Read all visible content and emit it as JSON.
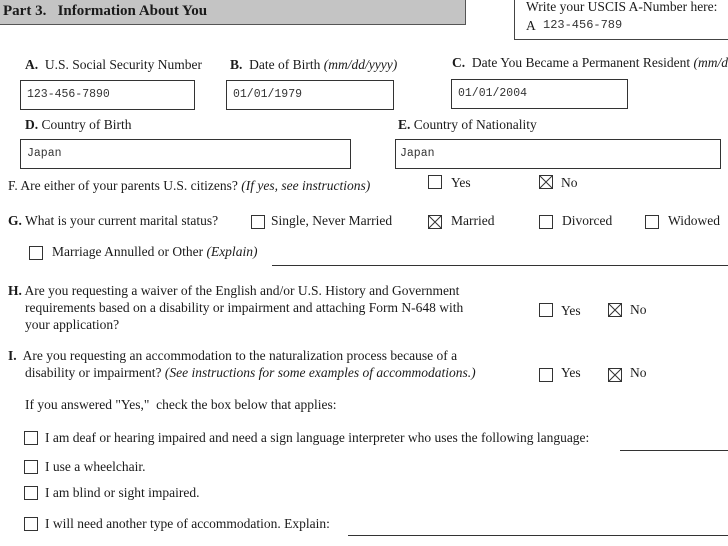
{
  "part": {
    "title": "Part 3.   Information About You"
  },
  "a_number": {
    "label": "Write your USCIS  A-Number here:",
    "prefix": "A",
    "value": "123-456-789"
  },
  "fields": {
    "ssn": {
      "letter": "A.",
      "label": "U.S. Social Security Number",
      "value": "123-456-7890"
    },
    "dob": {
      "letter": "B.",
      "label": "Date of Birth",
      "hint": "(mm/dd/yyyy)",
      "value": "01/01/1979"
    },
    "pr_date": {
      "letter": "C.",
      "label": "Date You Became a Permanent Resident",
      "hint": "(mm/dd/yyyy)",
      "value": "01/01/2004"
    },
    "birth_country": {
      "letter": "D.",
      "label": "Country of Birth",
      "value": "Japan"
    },
    "nationality": {
      "letter": "E.",
      "label": "Country of Nationality",
      "value": "Japan"
    }
  },
  "questions": {
    "f": {
      "text": "F. Are either of your parents U.S. citizens?",
      "hint": "(If yes, see instructions)",
      "options": [
        {
          "label": "Yes",
          "checked": false
        },
        {
          "label": "No",
          "checked": true
        }
      ]
    },
    "g": {
      "letter": "G.",
      "text": "What is your current marital status?",
      "options": [
        {
          "label": "Single, Never Married",
          "checked": false
        },
        {
          "label": "Married",
          "checked": true
        },
        {
          "label": "Divorced",
          "checked": false
        },
        {
          "label": "Widowed",
          "checked": false
        }
      ],
      "other": {
        "label": "Marriage Annulled or Other",
        "hint": "(Explain)",
        "checked": false,
        "value": ""
      }
    },
    "h": {
      "letter": "H.",
      "lines": [
        "Are you requesting a waiver of the English and/or U.S. History and Government",
        "requirements based on a disability or impairment and attaching Form N-648 with",
        "your application?"
      ],
      "options": [
        {
          "label": "Yes",
          "checked": false
        },
        {
          "label": "No",
          "checked": true
        }
      ]
    },
    "i": {
      "letter": "I.",
      "line1": "Are you requesting an accommodation to the naturalization process because of a",
      "line2": "disability or impairment?",
      "hint": "(See instructions for some examples of accommodations.)",
      "options": [
        {
          "label": "Yes",
          "checked": false
        },
        {
          "label": "No",
          "checked": true
        }
      ],
      "followup": "If you answered \"Yes,\"  check the box below that applies:",
      "accommodations": [
        {
          "label": "I am deaf or hearing impaired and need a sign language interpreter who uses the following language:",
          "checked": false,
          "value": ""
        },
        {
          "label": "I use a wheelchair.",
          "checked": false
        },
        {
          "label": "I am blind or sight impaired.",
          "checked": false
        },
        {
          "label": "I will need another type of accommodation. Explain:",
          "checked": false,
          "value": ""
        }
      ]
    }
  }
}
